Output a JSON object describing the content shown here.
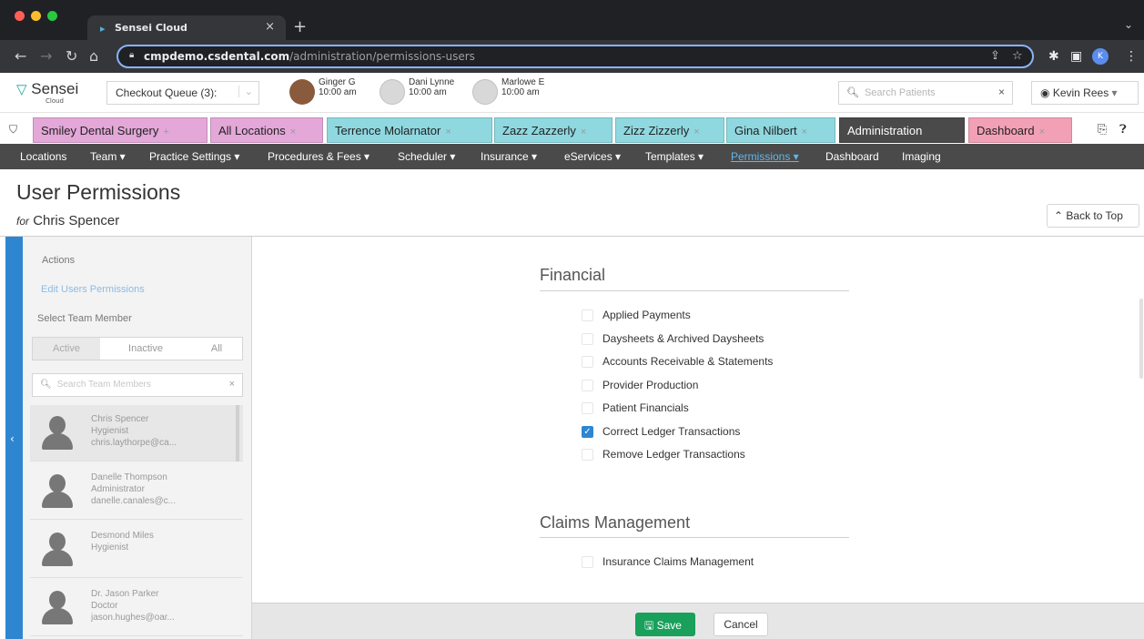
{
  "browser": {
    "tab_title": "Sensei Cloud",
    "url_host": "cmpdemo.csdental.com",
    "url_path": "/administration/permissions-users",
    "profile_initial": "K"
  },
  "header": {
    "logo_text": "Sensei",
    "logo_sub": "Cloud",
    "queue_label": "Checkout Queue (3):",
    "patients": [
      {
        "name": "Ginger G",
        "time": "10:00 am"
      },
      {
        "name": "Dani Lynne",
        "time": "10:00 am"
      },
      {
        "name": "Marlowe E",
        "time": "10:00 am"
      }
    ],
    "search_placeholder": "Search Patients",
    "user_name": "Kevin Rees"
  },
  "tabs": [
    {
      "label": "Smiley Dental Surgery",
      "color": "#e3a7d8"
    },
    {
      "label": "All Locations",
      "color": "#e3a7d8"
    },
    {
      "label": "Terrence Molarnator",
      "color": "#8fd8e0"
    },
    {
      "label": "Zazz Zazzerly",
      "color": "#8fd8e0"
    },
    {
      "label": "Zizz Zizzerly",
      "color": "#8fd8e0"
    },
    {
      "label": "Gina Nilbert",
      "color": "#8fd8e0"
    },
    {
      "label": "Administration",
      "color": "#4a4a4a"
    },
    {
      "label": "Dashboard",
      "color": "#f2a0b6"
    }
  ],
  "nav": {
    "items": [
      "Locations",
      "Team ▾",
      "Practice Settings ▾",
      "Procedures & Fees ▾",
      "Scheduler ▾",
      "Insurance ▾",
      "eServices ▾",
      "Templates ▾",
      "Permissions ▾",
      "Dashboard",
      "Imaging"
    ]
  },
  "page": {
    "title": "User Permissions",
    "for_label": "for",
    "for_name": "Chris Spencer",
    "back_to_top": "Back to Top"
  },
  "left": {
    "actions_label": "Actions",
    "edit_link": "Edit Users Permissions",
    "select_label": "Select Team Member",
    "filters": [
      "Active",
      "Inactive",
      "All"
    ],
    "search_placeholder": "Search Team Members",
    "members": [
      {
        "name": "Chris Spencer",
        "role": "Hygienist",
        "email": "chris.laythorpe@ca..."
      },
      {
        "name": "Danelle Thompson",
        "role": "Administrator",
        "email": "danelle.canales@c..."
      },
      {
        "name": "Desmond Miles",
        "role": "Hygienist",
        "email": ""
      },
      {
        "name": "Dr. Jason Parker",
        "role": "Doctor",
        "email": "jason.hughes@oar..."
      }
    ]
  },
  "sections": [
    {
      "title": "Financial",
      "items": [
        {
          "label": "Applied Payments",
          "checked": false
        },
        {
          "label": "Daysheets & Archived Daysheets",
          "checked": false
        },
        {
          "label": "Accounts Receivable & Statements",
          "checked": false
        },
        {
          "label": "Provider Production",
          "checked": false
        },
        {
          "label": "Patient Financials",
          "checked": false
        },
        {
          "label": "Correct Ledger Transactions",
          "checked": true
        },
        {
          "label": "Remove Ledger Transactions",
          "checked": false
        }
      ]
    },
    {
      "title": "Claims Management",
      "items": [
        {
          "label": "Insurance Claims Management",
          "checked": false
        }
      ]
    }
  ],
  "footer": {
    "save_label": "Save",
    "cancel_label": "Cancel"
  },
  "colors": {
    "accent": "#2e86d1",
    "save": "#19a05a",
    "nav": "#4a4a4a"
  }
}
